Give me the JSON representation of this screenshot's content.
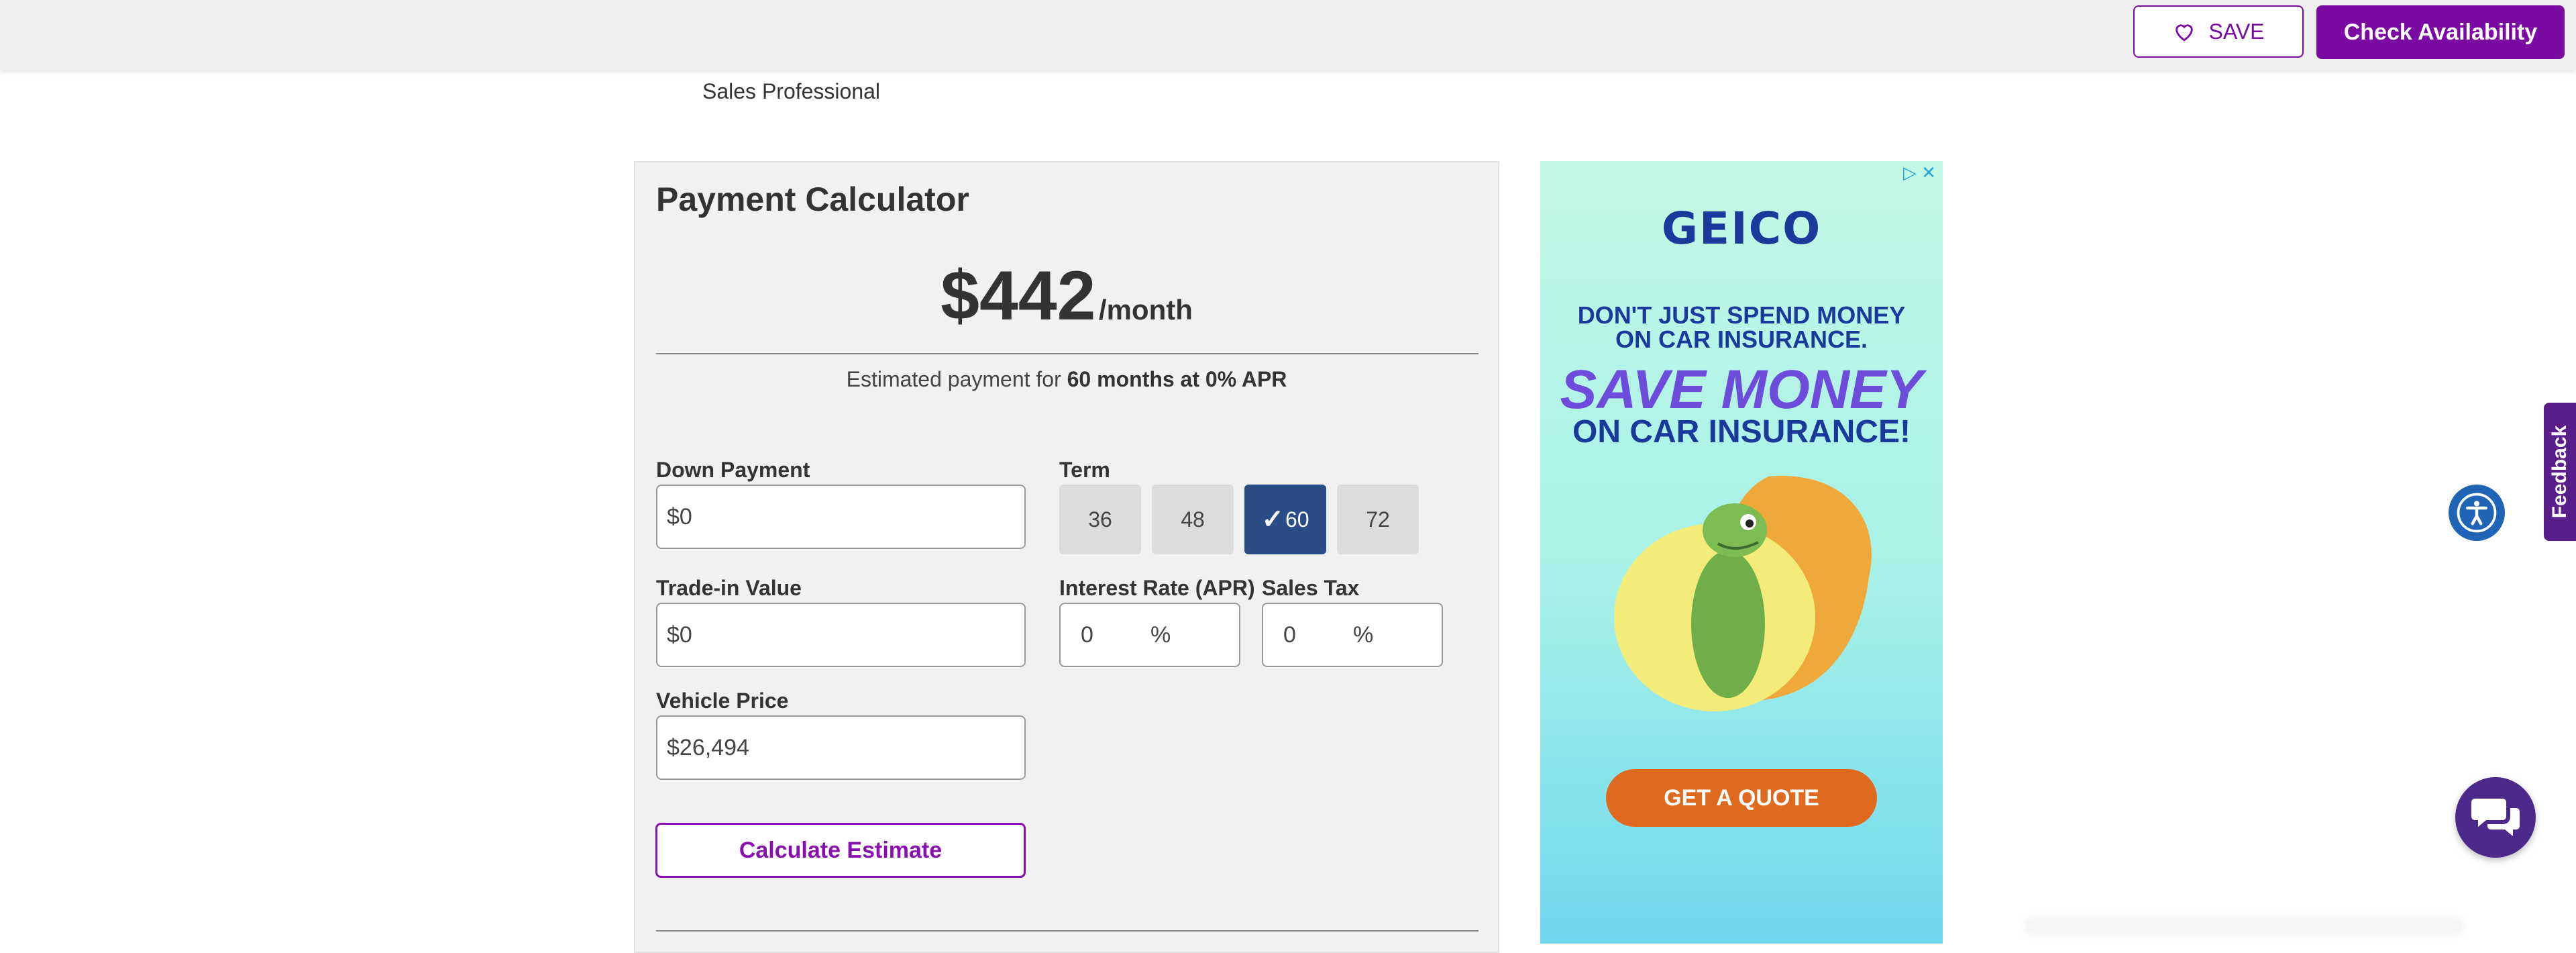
{
  "header": {
    "save_label": "SAVE",
    "check_label": "Check Availability"
  },
  "dealer": {
    "sales_professional": "Sales Professional"
  },
  "calculator": {
    "title": "Payment Calculator",
    "monthly_amount": "$442",
    "per_month": "/month",
    "estimate_prefix": "Estimated payment for",
    "estimate_bold": "60 months at 0% APR",
    "down_payment_label": "Down Payment",
    "down_payment_value": "$0",
    "trade_in_label": "Trade-in Value",
    "trade_in_value": "$0",
    "vehicle_price_label": "Vehicle Price",
    "vehicle_price_value": "$26,494",
    "term_label": "Term",
    "terms": [
      "36",
      "48",
      "60",
      "72"
    ],
    "selected_term": "60",
    "interest_label": "Interest Rate (APR)",
    "interest_value": "0",
    "interest_unit": "%",
    "sales_tax_label": "Sales Tax",
    "sales_tax_value": "0",
    "sales_tax_unit": "%",
    "calculate_label": "Calculate Estimate"
  },
  "ad": {
    "logo": "GEICO",
    "line1a": "DON'T JUST SPEND MONEY",
    "line1b": "ON CAR INSURANCE.",
    "line2": "SAVE MONEY",
    "line3": "ON CAR INSURANCE!",
    "cta": "GET A QUOTE",
    "choices": "▷ ✕"
  },
  "widgets": {
    "feedback": "Feedback"
  },
  "colors": {
    "brand_purple": "#7b0aa3",
    "term_active": "#2a4d86",
    "ad_orange": "#df6a1f",
    "ad_blue": "#1a3a9b"
  }
}
